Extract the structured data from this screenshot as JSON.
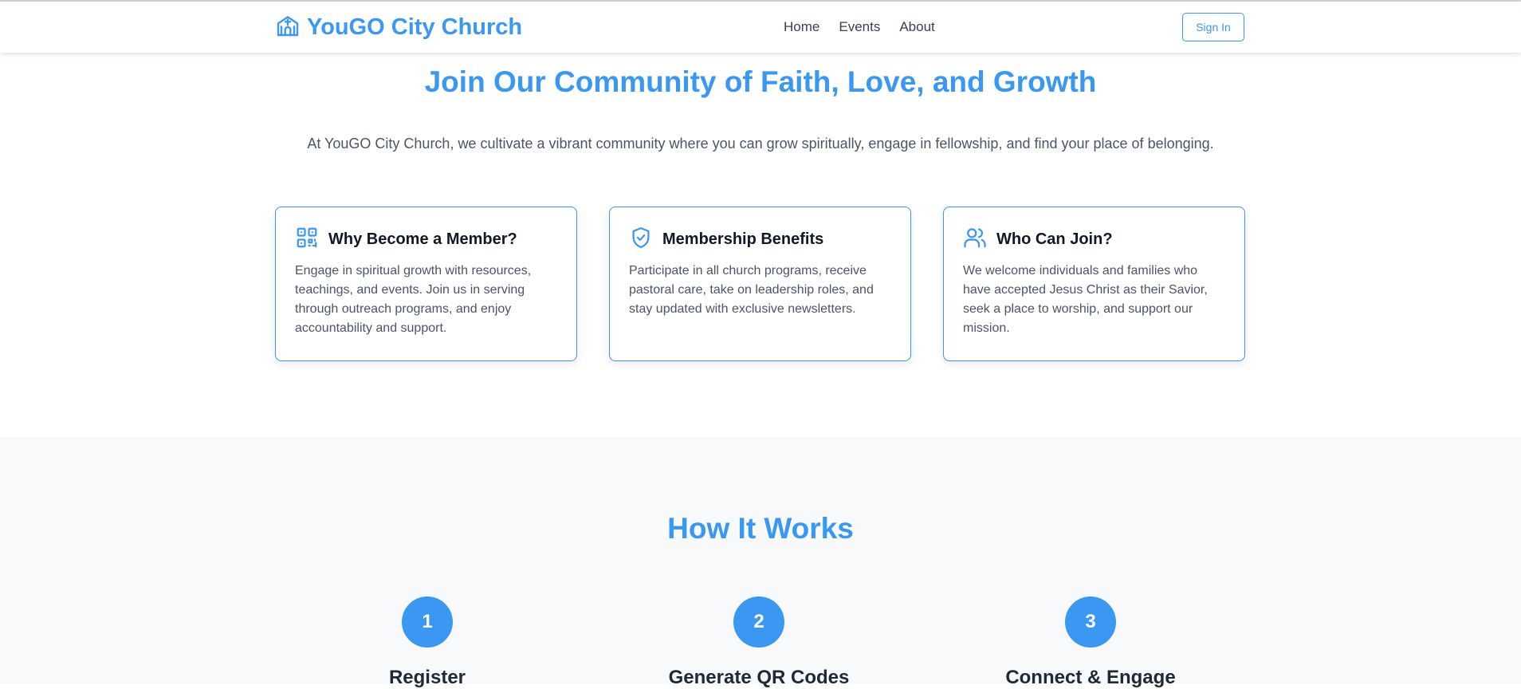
{
  "header": {
    "brand_name": "YouGO City Church",
    "brand_icon": "church-icon",
    "nav": [
      "Home",
      "Events",
      "About"
    ],
    "sign_in_label": "Sign In"
  },
  "hero": {
    "title": "Join Our Community of Faith, Love, and Growth",
    "subtitle": "At YouGO City Church, we cultivate a vibrant community where you can grow spiritually, engage in fellowship, and find your place of belonging."
  },
  "cards": [
    {
      "icon": "qr-code-icon",
      "title": "Why Become a Member?",
      "text": "Engage in spiritual growth with resources, teachings, and events. Join us in serving through outreach programs, and enjoy accountability and support."
    },
    {
      "icon": "shield-check-icon",
      "title": "Membership Benefits",
      "text": "Participate in all church programs, receive pastoral care, take on leadership roles, and stay updated with exclusive newsletters."
    },
    {
      "icon": "users-icon",
      "title": "Who Can Join?",
      "text": "We welcome individuals and families who have accepted Jesus Christ as their Savior, seek a place to worship, and support our mission."
    }
  ],
  "how_it_works": {
    "title": "How It Works",
    "steps": [
      {
        "number": "1",
        "title": "Register"
      },
      {
        "number": "2",
        "title": "Generate QR Codes"
      },
      {
        "number": "3",
        "title": "Connect & Engage"
      }
    ]
  },
  "colors": {
    "accent": "#3a97f2",
    "section_bg": "#f8f9fa",
    "text_muted": "#4b5563"
  }
}
